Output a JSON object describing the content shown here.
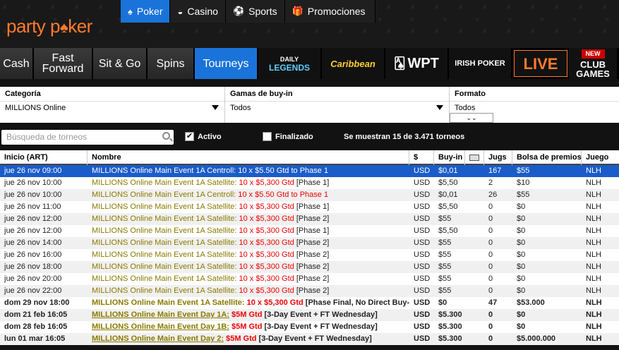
{
  "brand": {
    "logo_left": "party",
    "logo_right": "ker",
    "accent": "#ff7a2e",
    "blue": "#1a73d9"
  },
  "topnav": [
    {
      "label": "Poker",
      "icon": "spade-icon",
      "active": true
    },
    {
      "label": "Casino",
      "icon": "casino-icon",
      "active": false
    },
    {
      "label": "Sports",
      "icon": "soccer-ball-icon",
      "active": false
    },
    {
      "label": "Promociones",
      "icon": "gift-icon",
      "active": false
    }
  ],
  "gametabs": {
    "cash": "Cash",
    "fast_forward": "Fast Forward",
    "sitgo": "Sit & Go",
    "spins": "Spins",
    "tourneys": "Tourneys",
    "daily_legends_top": "DAILY",
    "daily_legends_bottom": "LEGENDS",
    "caribbean": "Caribbean",
    "wpt": "WPT",
    "irish_poker": "IRISH POKER",
    "live": "LIVE",
    "club_new": "NEW",
    "club_top": "CLUB",
    "club_bottom": "GAMES"
  },
  "filters": {
    "category_label": "Categoría",
    "category_value": "MILLIONS Online",
    "buyin_label": "Gamas de buy-in",
    "buyin_value": "Todos",
    "format_label": "Formato",
    "format_value": "Todos"
  },
  "search": {
    "placeholder": "Búsqueda de torneos",
    "active_label": "Activo",
    "active_checked": "✔",
    "finished_label": "Finalizado",
    "count_text": "Se muestran 15 de 3.471 torneos"
  },
  "table": {
    "headers": [
      "Inicio (ART)",
      "Nombre",
      "$",
      "Buy-in",
      "",
      "Jugs",
      "Bolsa de premios",
      "Juego"
    ],
    "rows": [
      {
        "start": "jue 26 nov 09:00",
        "name_a": "MILLIONS Online Main Event 1A Centroll: 10 x $5.50 Gtd to Phase 1",
        "name_b": "",
        "name_c": "",
        "currency": "USD",
        "buyin": "$0,01",
        "players": "167",
        "prize": "$55",
        "game": "NLH"
      },
      {
        "start": "jue 26 nov 10:00",
        "name_a": "MILLIONS Online Main Event 1A Satellite: ",
        "name_b": "10 x $5,300 Gtd",
        "name_c": " [Phase 1]",
        "currency": "USD",
        "buyin": "$5,50",
        "players": "2",
        "prize": "$10",
        "game": "NLH"
      },
      {
        "start": "jue 26 nov 10:00",
        "name_a": "MILLIONS Online Main Event 1A Centroll: ",
        "name_b": "10 x $5.50 Gtd to Phase 1",
        "name_c": "",
        "currency": "USD",
        "buyin": "$0,01",
        "players": "26",
        "prize": "$55",
        "game": "NLH"
      },
      {
        "start": "jue 26 nov 11:00",
        "name_a": "MILLIONS Online Main Event 1A Satellite: ",
        "name_b": "10 x $5,300 Gtd",
        "name_c": " [Phase 1]",
        "currency": "USD",
        "buyin": "$5,50",
        "players": "0",
        "prize": "$0",
        "game": "NLH"
      },
      {
        "start": "jue 26 nov 12:00",
        "name_a": "MILLIONS Online Main Event 1A Satellite: ",
        "name_b": "10 x $5,300 Gtd",
        "name_c": " [Phase 2]",
        "currency": "USD",
        "buyin": "$55",
        "players": "0",
        "prize": "$0",
        "game": "NLH"
      },
      {
        "start": "jue 26 nov 12:00",
        "name_a": "MILLIONS Online Main Event 1A Satellite: ",
        "name_b": "10 x $5,300 Gtd",
        "name_c": " [Phase 1]",
        "currency": "USD",
        "buyin": "$5,50",
        "players": "0",
        "prize": "$0",
        "game": "NLH"
      },
      {
        "start": "jue 26 nov 14:00",
        "name_a": "MILLIONS Online Main Event 1A Satellite: ",
        "name_b": "10 x $5,300 Gtd",
        "name_c": " [Phase 2]",
        "currency": "USD",
        "buyin": "$55",
        "players": "0",
        "prize": "$0",
        "game": "NLH"
      },
      {
        "start": "jue 26 nov 16:00",
        "name_a": "MILLIONS Online Main Event 1A Satellite: ",
        "name_b": "10 x $5,300 Gtd",
        "name_c": " [Phase 2]",
        "currency": "USD",
        "buyin": "$55",
        "players": "0",
        "prize": "$0",
        "game": "NLH"
      },
      {
        "start": "jue 26 nov 18:00",
        "name_a": "MILLIONS Online Main Event 1A Satellite: ",
        "name_b": "10 x $5,300 Gtd",
        "name_c": " [Phase 2]",
        "currency": "USD",
        "buyin": "$55",
        "players": "0",
        "prize": "$0",
        "game": "NLH"
      },
      {
        "start": "jue 26 nov 20:00",
        "name_a": "MILLIONS Online Main Event 1A Satellite: ",
        "name_b": "10 x $5,300 Gtd",
        "name_c": " [Phase 2]",
        "currency": "USD",
        "buyin": "$55",
        "players": "0",
        "prize": "$0",
        "game": "NLH"
      },
      {
        "start": "jue 26 nov 22:00",
        "name_a": "MILLIONS Online Main Event 1A Satellite: ",
        "name_b": "10 x $5,300 Gtd",
        "name_c": " [Phase 2]",
        "currency": "USD",
        "buyin": "$55",
        "players": "0",
        "prize": "$0",
        "game": "NLH"
      },
      {
        "start": "dom 29 nov 18:00",
        "name_a": "MILLIONS Online Main Event 1A Satellite:",
        "name_b": " 10 x $5,300 Gtd",
        "name_c": " [Phase Final, No Direct Buy-In]",
        "currency": "USD",
        "buyin": "$0",
        "players": "47",
        "prize": "$53.000",
        "game": "NLH"
      },
      {
        "start": "dom 21 feb 16:05",
        "name_a": "MILLIONS Online Main Event Day 1A:",
        "name_b": " $5M Gtd",
        "name_c": " [3-Day Event + FT Wednesday]",
        "currency": "USD",
        "buyin": "$5.300",
        "players": "0",
        "prize": "$0",
        "game": "NLH"
      },
      {
        "start": "dom 28 feb 16:05",
        "name_a": "MILLIONS Online Main Event Day 1B:",
        "name_b": " $5M Gtd",
        "name_c": " [3-Day Event + FT Wednesday]",
        "currency": "USD",
        "buyin": "$5.300",
        "players": "0",
        "prize": "$0",
        "game": "NLH"
      },
      {
        "start": "lun 01 mar 16:05",
        "name_a": "MILLIONS Online Main Event Day 2:",
        "name_b": " $5M Gtd",
        "name_c": " [3-Day Event + FT Wednesday]",
        "currency": "USD",
        "buyin": "$5.300",
        "players": "0",
        "prize": "$5.000.000",
        "game": "NLH"
      }
    ]
  }
}
